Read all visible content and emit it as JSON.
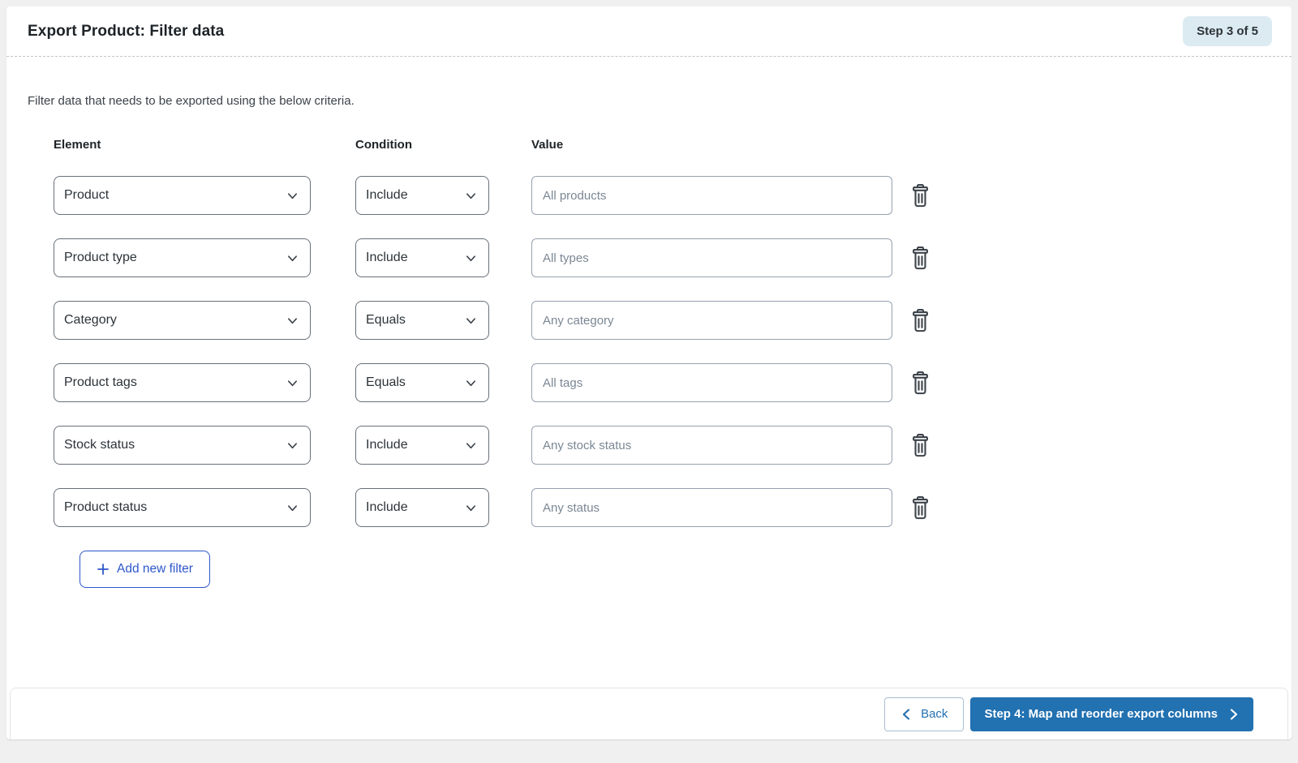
{
  "header": {
    "title": "Export Product: Filter data",
    "step_badge": "Step 3 of 5"
  },
  "intro": "Filter data that needs to be exported using the below criteria.",
  "columns": {
    "element": "Element",
    "condition": "Condition",
    "value": "Value"
  },
  "filters": [
    {
      "element": "Product",
      "condition": "Include",
      "value_placeholder": "All products"
    },
    {
      "element": "Product type",
      "condition": "Include",
      "value_placeholder": "All types"
    },
    {
      "element": "Category",
      "condition": "Equals",
      "value_placeholder": "Any category"
    },
    {
      "element": "Product tags",
      "condition": "Equals",
      "value_placeholder": "All tags"
    },
    {
      "element": "Stock status",
      "condition": "Include",
      "value_placeholder": "Any stock status"
    },
    {
      "element": "Product status",
      "condition": "Include",
      "value_placeholder": "Any status"
    }
  ],
  "add_filter": {
    "label": "Add new filter"
  },
  "footer": {
    "back_label": "Back",
    "next_label": "Step 4: Map and reorder export columns"
  },
  "colors": {
    "primary_blue": "#2271b1",
    "add_filter_blue": "#2e57c9",
    "badge_bg": "#dcebf2",
    "page_bg": "#f0f0f1",
    "icon_dark": "#3c434a"
  }
}
